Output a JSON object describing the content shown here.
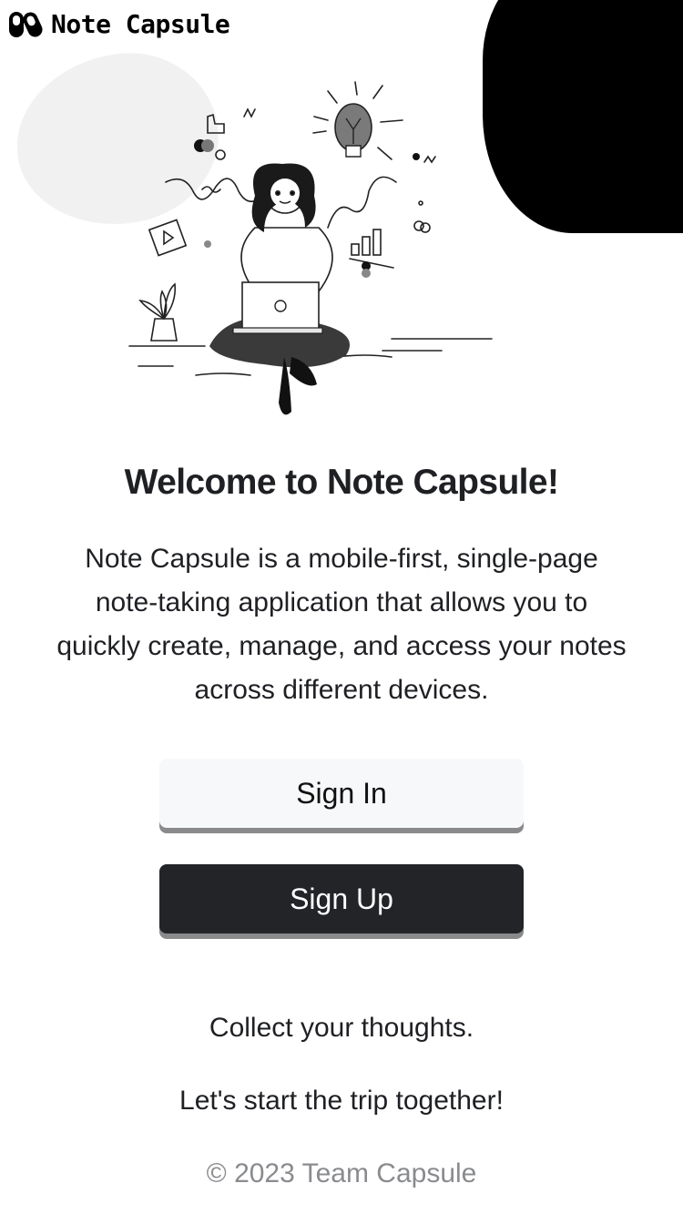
{
  "brand": {
    "name": "Note Capsule",
    "logo_icon": "capsule-logo-icon"
  },
  "welcome": {
    "title": "Welcome to Note Capsule!",
    "description": "Note Capsule is a mobile-first, single-page note-taking application that allows you to quickly create, manage, and access your notes across different devices."
  },
  "actions": {
    "sign_in_label": "Sign In",
    "sign_up_label": "Sign Up"
  },
  "taglines": {
    "line1": "Collect your thoughts.",
    "line2": "Let's start the trip together!"
  },
  "footer": {
    "copyright": "© 2023 Team Capsule"
  },
  "colors": {
    "primary_dark": "#222428",
    "secondary_light": "#f7f8fa",
    "text": "#1f2024",
    "muted": "#8a8b8f"
  }
}
